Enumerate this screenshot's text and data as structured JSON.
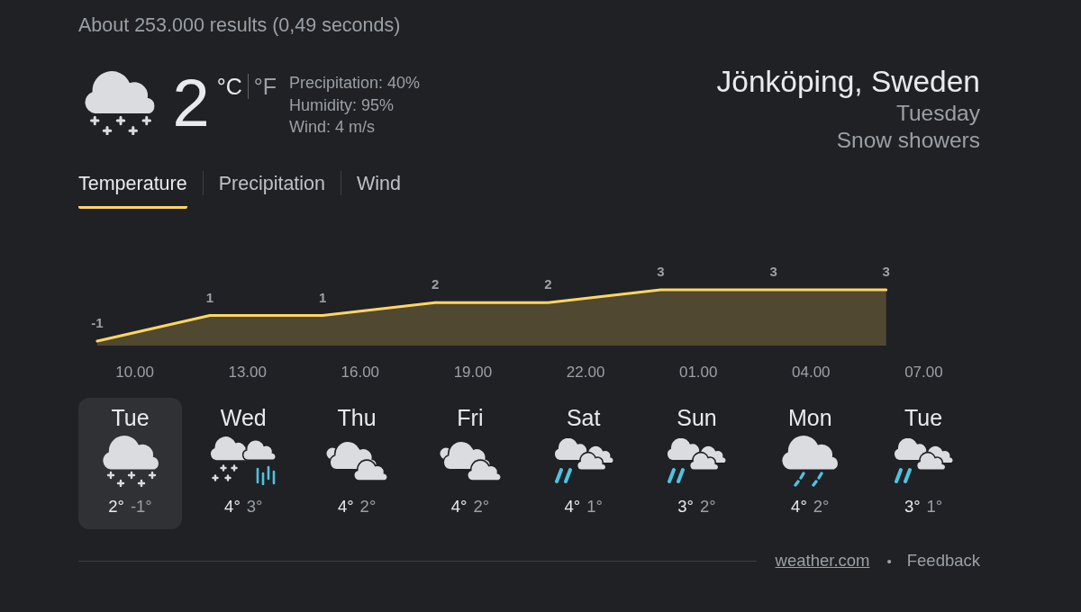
{
  "results_info": "About 253.000 results (0,49 seconds)",
  "current": {
    "kind": "snow",
    "temperature": "2",
    "units": [
      {
        "label": "°C",
        "selected": true
      },
      {
        "label": "°F",
        "selected": false
      }
    ],
    "details": [
      "Precipitation: 40%",
      "Humidity: 95%",
      "Wind: 4 m/s"
    ]
  },
  "location": {
    "name": "Jönköping, Sweden",
    "day": "Tuesday",
    "condition": "Snow showers"
  },
  "tabs": [
    {
      "label": "Temperature",
      "selected": true
    },
    {
      "label": "Precipitation",
      "selected": false
    },
    {
      "label": "Wind",
      "selected": false
    }
  ],
  "chart": {
    "chart_data": {
      "type": "area",
      "categories": [
        null,
        "10.00",
        null,
        null,
        "13.00",
        null,
        null,
        "16.00",
        null,
        null,
        "19.00",
        null,
        null,
        "22.00",
        null,
        null,
        "01.00",
        null,
        null,
        "04.00",
        null,
        null,
        "07.00",
        null
      ],
      "series": [
        {
          "color": "#fdd663",
          "values": [
            -1,
            null,
            null,
            1,
            null,
            null,
            1,
            null,
            null,
            2,
            null,
            null,
            2,
            null,
            null,
            3,
            null,
            null,
            3,
            null,
            null,
            3,
            null,
            null
          ]
        }
      ],
      "data_labels": true
    }
  },
  "forecast": [
    {
      "day": "Tue",
      "kind": "snow",
      "high": "2°",
      "low": "-1°",
      "selected": true
    },
    {
      "day": "Wed",
      "kind": "mixed",
      "high": "4°",
      "low": "3°",
      "selected": false
    },
    {
      "day": "Thu",
      "kind": "cloudy",
      "high": "4°",
      "low": "2°",
      "selected": false
    },
    {
      "day": "Fri",
      "kind": "cloudy",
      "high": "4°",
      "low": "2°",
      "selected": false
    },
    {
      "day": "Sat",
      "kind": "showers",
      "high": "4°",
      "low": "1°",
      "selected": false
    },
    {
      "day": "Sun",
      "kind": "showers",
      "high": "3°",
      "low": "2°",
      "selected": false
    },
    {
      "day": "Mon",
      "kind": "rain",
      "high": "4°",
      "low": "2°",
      "selected": false
    },
    {
      "day": "Tue",
      "kind": "showers",
      "high": "3°",
      "low": "1°",
      "selected": false
    }
  ],
  "footer": {
    "source": "weather.com",
    "separator": "•",
    "feedback": "Feedback"
  }
}
